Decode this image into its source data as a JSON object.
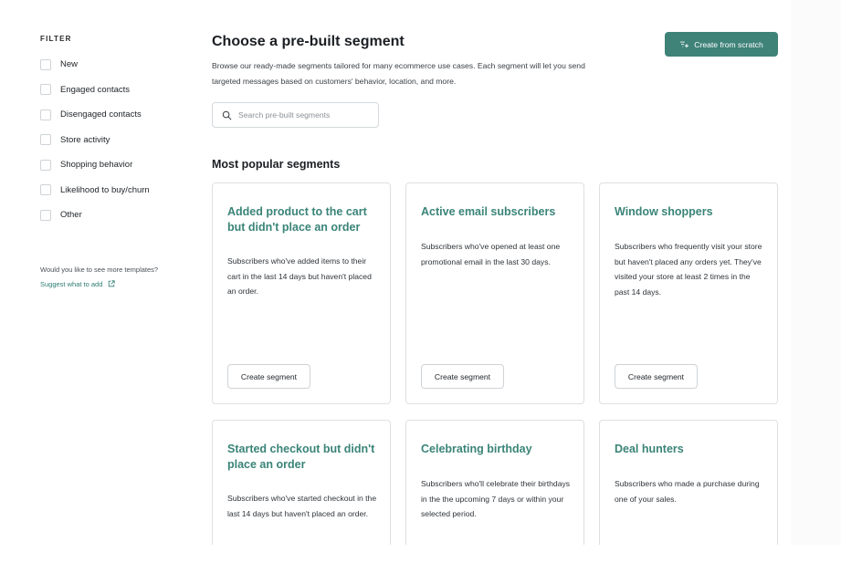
{
  "sidebar": {
    "heading": "FILTER",
    "filters": [
      {
        "label": "New"
      },
      {
        "label": "Engaged contacts"
      },
      {
        "label": "Disengaged contacts"
      },
      {
        "label": "Store activity"
      },
      {
        "label": "Shopping behavior"
      },
      {
        "label": "Likelihood to buy/churn"
      },
      {
        "label": "Other"
      }
    ],
    "templates_note": "Would you like to see more templates?",
    "suggest_link": "Suggest what to add"
  },
  "header": {
    "title": "Choose a pre-built segment",
    "description": "Browse our ready-made segments tailored for many ecommerce use cases. Each segment will let you send targeted messages based on customers' behavior, location, and more.",
    "create_button": "Create from scratch"
  },
  "search": {
    "placeholder": "Search pre-built segments"
  },
  "section": {
    "title": "Most popular segments"
  },
  "cards": [
    {
      "title": "Added product to the cart but didn't place an order",
      "description": "Subscribers who've added items to their cart in the last 14 days but haven't placed an order.",
      "button": "Create segment"
    },
    {
      "title": "Active email subscribers",
      "description": "Subscribers who've opened at least one promotional email in the last 30 days.",
      "button": "Create segment"
    },
    {
      "title": "Window shoppers",
      "description": "Subscribers who frequently visit your store but haven't placed any orders yet. They've visited your store at least 2 times in the past 14 days.",
      "button": "Create segment"
    },
    {
      "title": "Started checkout but didn't place an order",
      "description": "Subscribers who've started checkout in the last 14 days but haven't placed an order."
    },
    {
      "title": "Celebrating birthday",
      "description": "Subscribers who'll celebrate their birthdays in the the upcoming 7 days or within your selected period."
    },
    {
      "title": "Deal hunters",
      "description": "Subscribers who made a purchase during one of your sales."
    }
  ],
  "colors": {
    "accent": "#3e8278",
    "card_title": "#3a8478"
  },
  "icons": {
    "search": "search-icon",
    "create": "filter-plus-icon",
    "external": "external-link-icon"
  }
}
